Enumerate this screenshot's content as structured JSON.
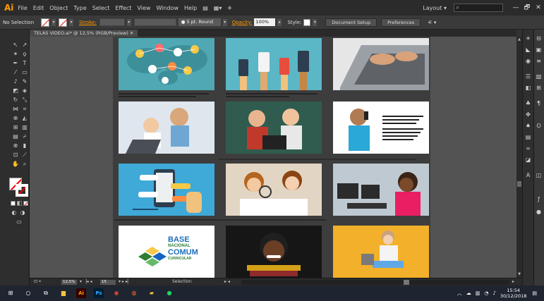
{
  "app": {
    "logo": "Ai",
    "menus": [
      "File",
      "Edit",
      "Object",
      "Type",
      "Select",
      "Effect",
      "View",
      "Window",
      "Help"
    ],
    "workspace": "Layout",
    "window_controls": [
      "—",
      "🗗",
      "✕"
    ]
  },
  "control_bar": {
    "selection_label": "No Selection",
    "stroke_label": "Stroke:",
    "stroke_weight": "5 pt. Round",
    "opacity_label": "Opacity:",
    "opacity_value": "100%",
    "style_label": "Style:",
    "document_setup": "Document Setup",
    "preferences": "Preferences"
  },
  "document": {
    "tab_title": "TELAS VIDEO.ai* @ 12,5% (RGB/Preview)",
    "tab_close": "✕"
  },
  "status_bar": {
    "zoom": "12,5%",
    "page": "15",
    "current_tool": "Selection"
  },
  "artwork": {
    "panel_bncc_line1": "BASE",
    "panel_bncc_line2": "NACIONAL",
    "panel_bncc_line3": "COMUM",
    "panel_bncc_line4": "CURRICULAR"
  },
  "taskbar": {
    "time": "15:54",
    "date": "30/12/2018"
  },
  "colors": {
    "app_bg": "#323232",
    "canvas_bg": "#535353",
    "accent": "#ff9a00",
    "panel_teal": "#4fa8b3",
    "panel_blue": "#3fa9d8",
    "panel_yellow": "#f3b02a"
  }
}
